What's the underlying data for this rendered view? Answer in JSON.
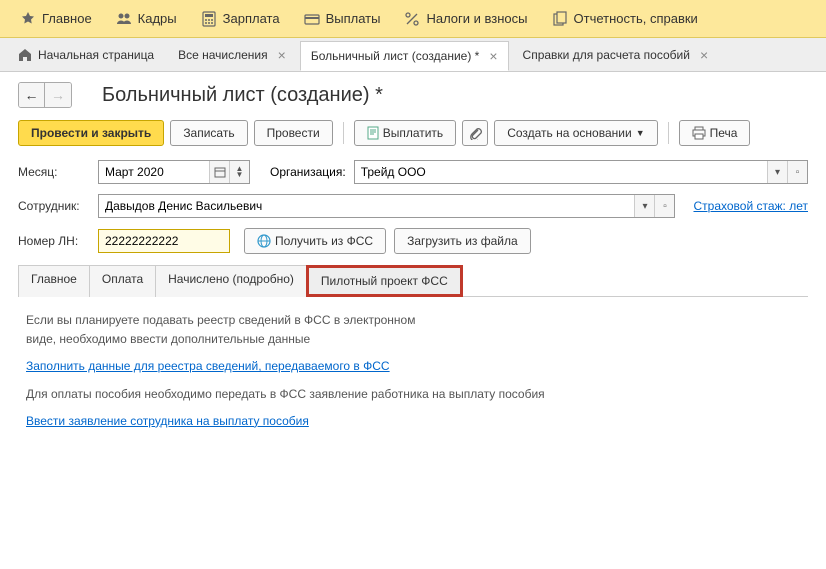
{
  "topnav": {
    "items": [
      {
        "label": "Главное"
      },
      {
        "label": "Кадры"
      },
      {
        "label": "Зарплата"
      },
      {
        "label": "Выплаты"
      },
      {
        "label": "Налоги и взносы"
      },
      {
        "label": "Отчетность, справки"
      }
    ]
  },
  "tabs": {
    "items": [
      {
        "label": "Начальная страница"
      },
      {
        "label": "Все начисления"
      },
      {
        "label": "Больничный лист (создание) *"
      },
      {
        "label": "Справки для расчета пособий"
      }
    ]
  },
  "page": {
    "title": "Больничный лист (создание) *"
  },
  "toolbar": {
    "submit": "Провести и закрыть",
    "save": "Записать",
    "post": "Провести",
    "pay": "Выплатить",
    "create_based": "Создать на основании",
    "print": "Печа"
  },
  "form": {
    "month_label": "Месяц:",
    "month_value": "Март 2020",
    "org_label": "Организация:",
    "org_value": "Трейд ООО",
    "employee_label": "Сотрудник:",
    "employee_value": "Давыдов Денис Васильевич",
    "insurance_link": "Страховой стаж: лет",
    "ln_label": "Номер ЛН:",
    "ln_value": "22222222222",
    "get_fss": "Получить из ФСС",
    "load_file": "Загрузить из файла"
  },
  "inner_tabs": {
    "items": [
      {
        "label": "Главное"
      },
      {
        "label": "Оплата"
      },
      {
        "label": "Начислено (подробно)"
      },
      {
        "label": "Пилотный проект ФСС"
      }
    ]
  },
  "panel": {
    "text1": "Если вы планируете подавать реестр сведений в ФСС в электронном виде, необходимо ввести дополнительные данные",
    "link1": "Заполнить данные для реестра сведений, передаваемого в ФСС",
    "text2": "Для оплаты пособия необходимо передать в ФСС заявление работника на выплату пособия",
    "link2": "Ввести заявление сотрудника на выплату пособия"
  }
}
